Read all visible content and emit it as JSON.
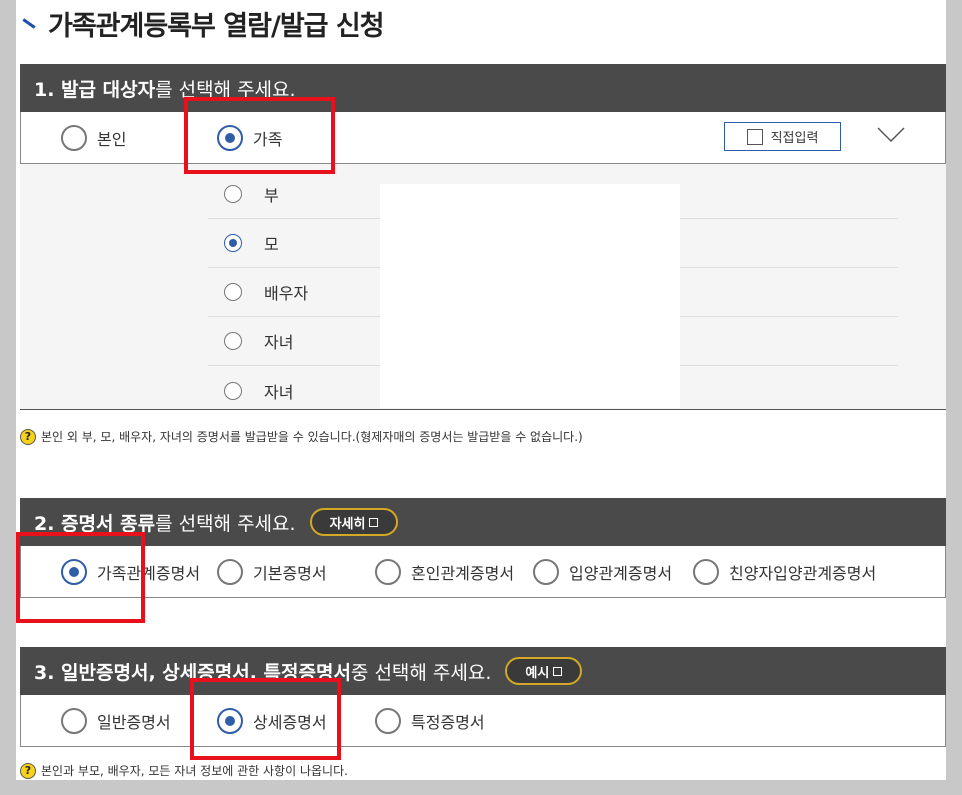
{
  "title": "가족관계등록부 열람/발급 신청",
  "section1": {
    "head_bold": "1. 발급 대상자",
    "head_rest": "를 선택해 주세요.",
    "options": [
      {
        "label": "본인",
        "selected": false
      },
      {
        "label": "가족",
        "selected": true
      }
    ],
    "direct_input_label": "직접입력",
    "family_members": [
      {
        "label": "부",
        "selected": false
      },
      {
        "label": "모",
        "selected": true
      },
      {
        "label": "배우자",
        "selected": false
      },
      {
        "label": "자녀",
        "selected": false
      },
      {
        "label": "자녀",
        "selected": false
      }
    ],
    "note": "본인 외 부, 모, 배우자, 자녀의 증명서를 발급받을 수 있습니다.(형제자매의 증명서는 발급받을 수 없습니다.)"
  },
  "section2": {
    "head_bold": "2. 증명서 종류",
    "head_rest": "를 선택해 주세요.",
    "button_label": "자세히",
    "options": [
      {
        "label": "가족관계증명서",
        "selected": true
      },
      {
        "label": "기본증명서",
        "selected": false
      },
      {
        "label": "혼인관계증명서",
        "selected": false
      },
      {
        "label": "입양관계증명서",
        "selected": false
      },
      {
        "label": "친양자입양관계증명서",
        "selected": false
      }
    ]
  },
  "section3": {
    "head_bold": "3. 일반증명서, 상세증명서, 특정증명서",
    "head_rest": " 중 선택해 주세요.",
    "button_label": "예시",
    "options": [
      {
        "label": "일반증명서",
        "selected": false
      },
      {
        "label": "상세증명서",
        "selected": true
      },
      {
        "label": "특정증명서",
        "selected": false
      }
    ],
    "note": "본인과 부모, 배우자, 모든 자녀 정보에 관한 사항이 나옵니다."
  },
  "colors": {
    "accent": "#2f5da8",
    "header_bg": "#4a4a4a",
    "highlight": "#e8101b",
    "pill_border": "#d4a824"
  }
}
